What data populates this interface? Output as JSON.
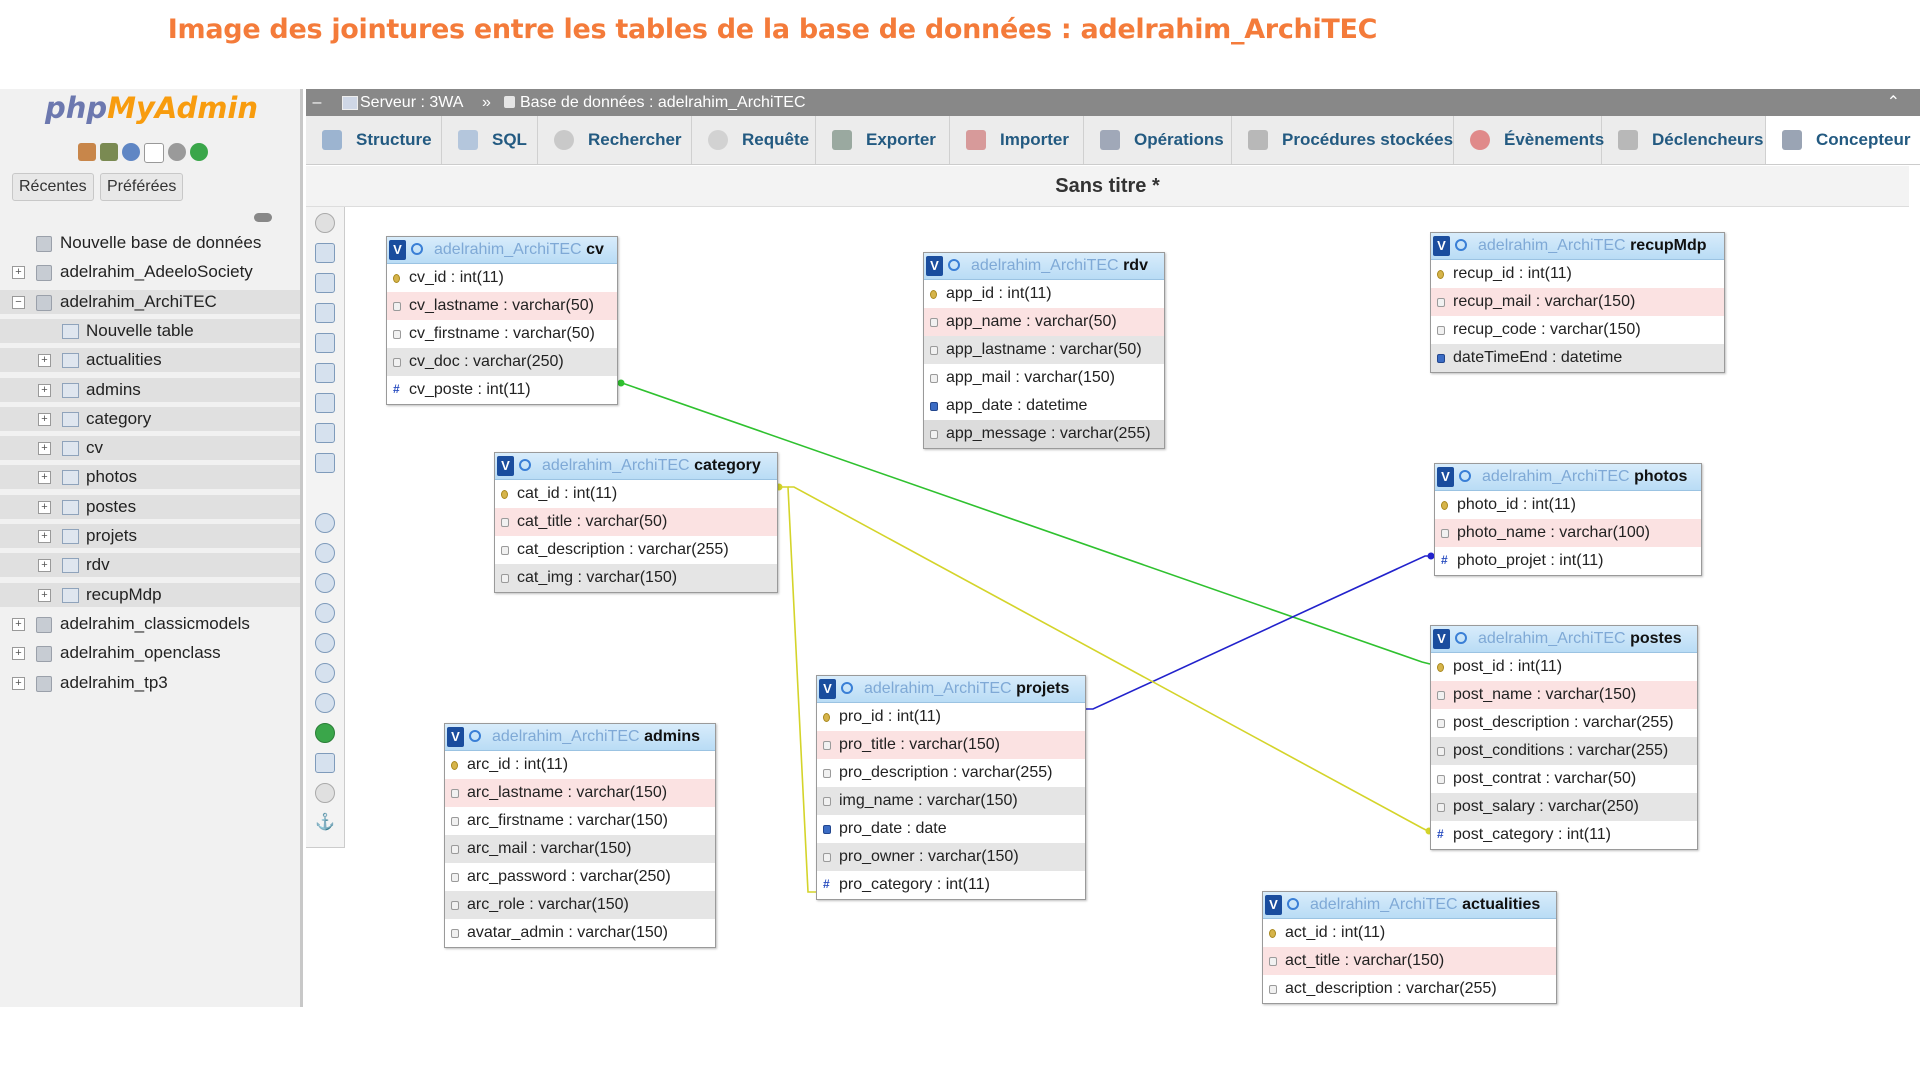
{
  "caption": "Image des jointures entre les tables de la base de données : adelrahim_ArchiTEC",
  "logo": {
    "part1": "php",
    "part2": "MyAdmin"
  },
  "left": {
    "recent_label": "Récentes",
    "favorites_label": "Préférées",
    "tree": [
      {
        "label": "Nouvelle base de données",
        "level": 0
      },
      {
        "label": "adelrahim_AdeeloSociety",
        "level": 0
      },
      {
        "label": "adelrahim_ArchiTEC",
        "level": 0
      },
      {
        "label": "Nouvelle table",
        "level": 1
      },
      {
        "label": "actualities",
        "level": 1
      },
      {
        "label": "admins",
        "level": 1
      },
      {
        "label": "category",
        "level": 1
      },
      {
        "label": "cv",
        "level": 1
      },
      {
        "label": "photos",
        "level": 1
      },
      {
        "label": "postes",
        "level": 1
      },
      {
        "label": "projets",
        "level": 1
      },
      {
        "label": "rdv",
        "level": 1
      },
      {
        "label": "recupMdp",
        "level": 1
      },
      {
        "label": "adelrahim_classicmodels",
        "level": 0
      },
      {
        "label": "adelrahim_openclass",
        "level": 0
      },
      {
        "label": "adelrahim_tp3",
        "level": 0
      }
    ]
  },
  "breadcrumb": {
    "server": "Serveur : 3WA",
    "sep": "»",
    "database": "Base de données : adelrahim_ArchiTEC"
  },
  "tabs": [
    "Structure",
    "SQL",
    "Rechercher",
    "Requête",
    "Exporter",
    "Importer",
    "Opérations",
    "Procédures stockées",
    "Évènements",
    "Déclencheurs",
    "Concepteur"
  ],
  "design_title": "Sans titre *",
  "db_prefix": "adelrahim_ArchiTEC",
  "tables": {
    "cv": {
      "name": "cv",
      "fields": [
        "cv_id : int(11)",
        "cv_lastname : varchar(50)",
        "cv_firstname : varchar(50)",
        "cv_doc : varchar(250)",
        "cv_poste : int(11)"
      ]
    },
    "rdv": {
      "name": "rdv",
      "fields": [
        "app_id : int(11)",
        "app_name : varchar(50)",
        "app_lastname : varchar(50)",
        "app_mail : varchar(150)",
        "app_date : datetime",
        "app_message : varchar(255)"
      ]
    },
    "recupMdp": {
      "name": "recupMdp",
      "fields": [
        "recup_id : int(11)",
        "recup_mail : varchar(150)",
        "recup_code : varchar(150)",
        "dateTimeEnd : datetime"
      ]
    },
    "category": {
      "name": "category",
      "fields": [
        "cat_id : int(11)",
        "cat_title : varchar(50)",
        "cat_description : varchar(255)",
        "cat_img : varchar(150)"
      ]
    },
    "photos": {
      "name": "photos",
      "fields": [
        "photo_id : int(11)",
        "photo_name : varchar(100)",
        "photo_projet : int(11)"
      ]
    },
    "postes": {
      "name": "postes",
      "fields": [
        "post_id : int(11)",
        "post_name : varchar(150)",
        "post_description : varchar(255)",
        "post_conditions : varchar(255)",
        "post_contrat : varchar(50)",
        "post_salary : varchar(250)",
        "post_category : int(11)"
      ]
    },
    "projets": {
      "name": "projets",
      "fields": [
        "pro_id : int(11)",
        "pro_title : varchar(150)",
        "pro_description : varchar(255)",
        "img_name : varchar(150)",
        "pro_date : date",
        "pro_owner : varchar(150)",
        "pro_category : int(11)"
      ]
    },
    "admins": {
      "name": "admins",
      "fields": [
        "arc_id : int(11)",
        "arc_lastname : varchar(150)",
        "arc_firstname : varchar(150)",
        "arc_mail : varchar(150)",
        "arc_password : varchar(250)",
        "arc_role : varchar(150)",
        "avatar_admin : varchar(150)"
      ]
    },
    "actualities": {
      "name": "actualities",
      "fields": [
        "act_id : int(11)",
        "act_title : varchar(150)",
        "act_description : varchar(255)"
      ]
    }
  },
  "relations": [
    {
      "from": "cv.cv_id",
      "to": "postes.post_id",
      "color": "#2fc12f"
    },
    {
      "from": "projets.pro_id",
      "to": "photos.photo_projet",
      "color": "#2222cc"
    },
    {
      "from": "category.cat_id",
      "to": "projets.pro_category",
      "color": "#d4d42a"
    },
    {
      "from": "category.cat_id",
      "to": "postes.post_category",
      "color": "#d4d42a"
    }
  ],
  "colors": {
    "caption": "#f47b3a",
    "tab_text": "#235a81",
    "breadcrumb_bg": "#888888"
  }
}
